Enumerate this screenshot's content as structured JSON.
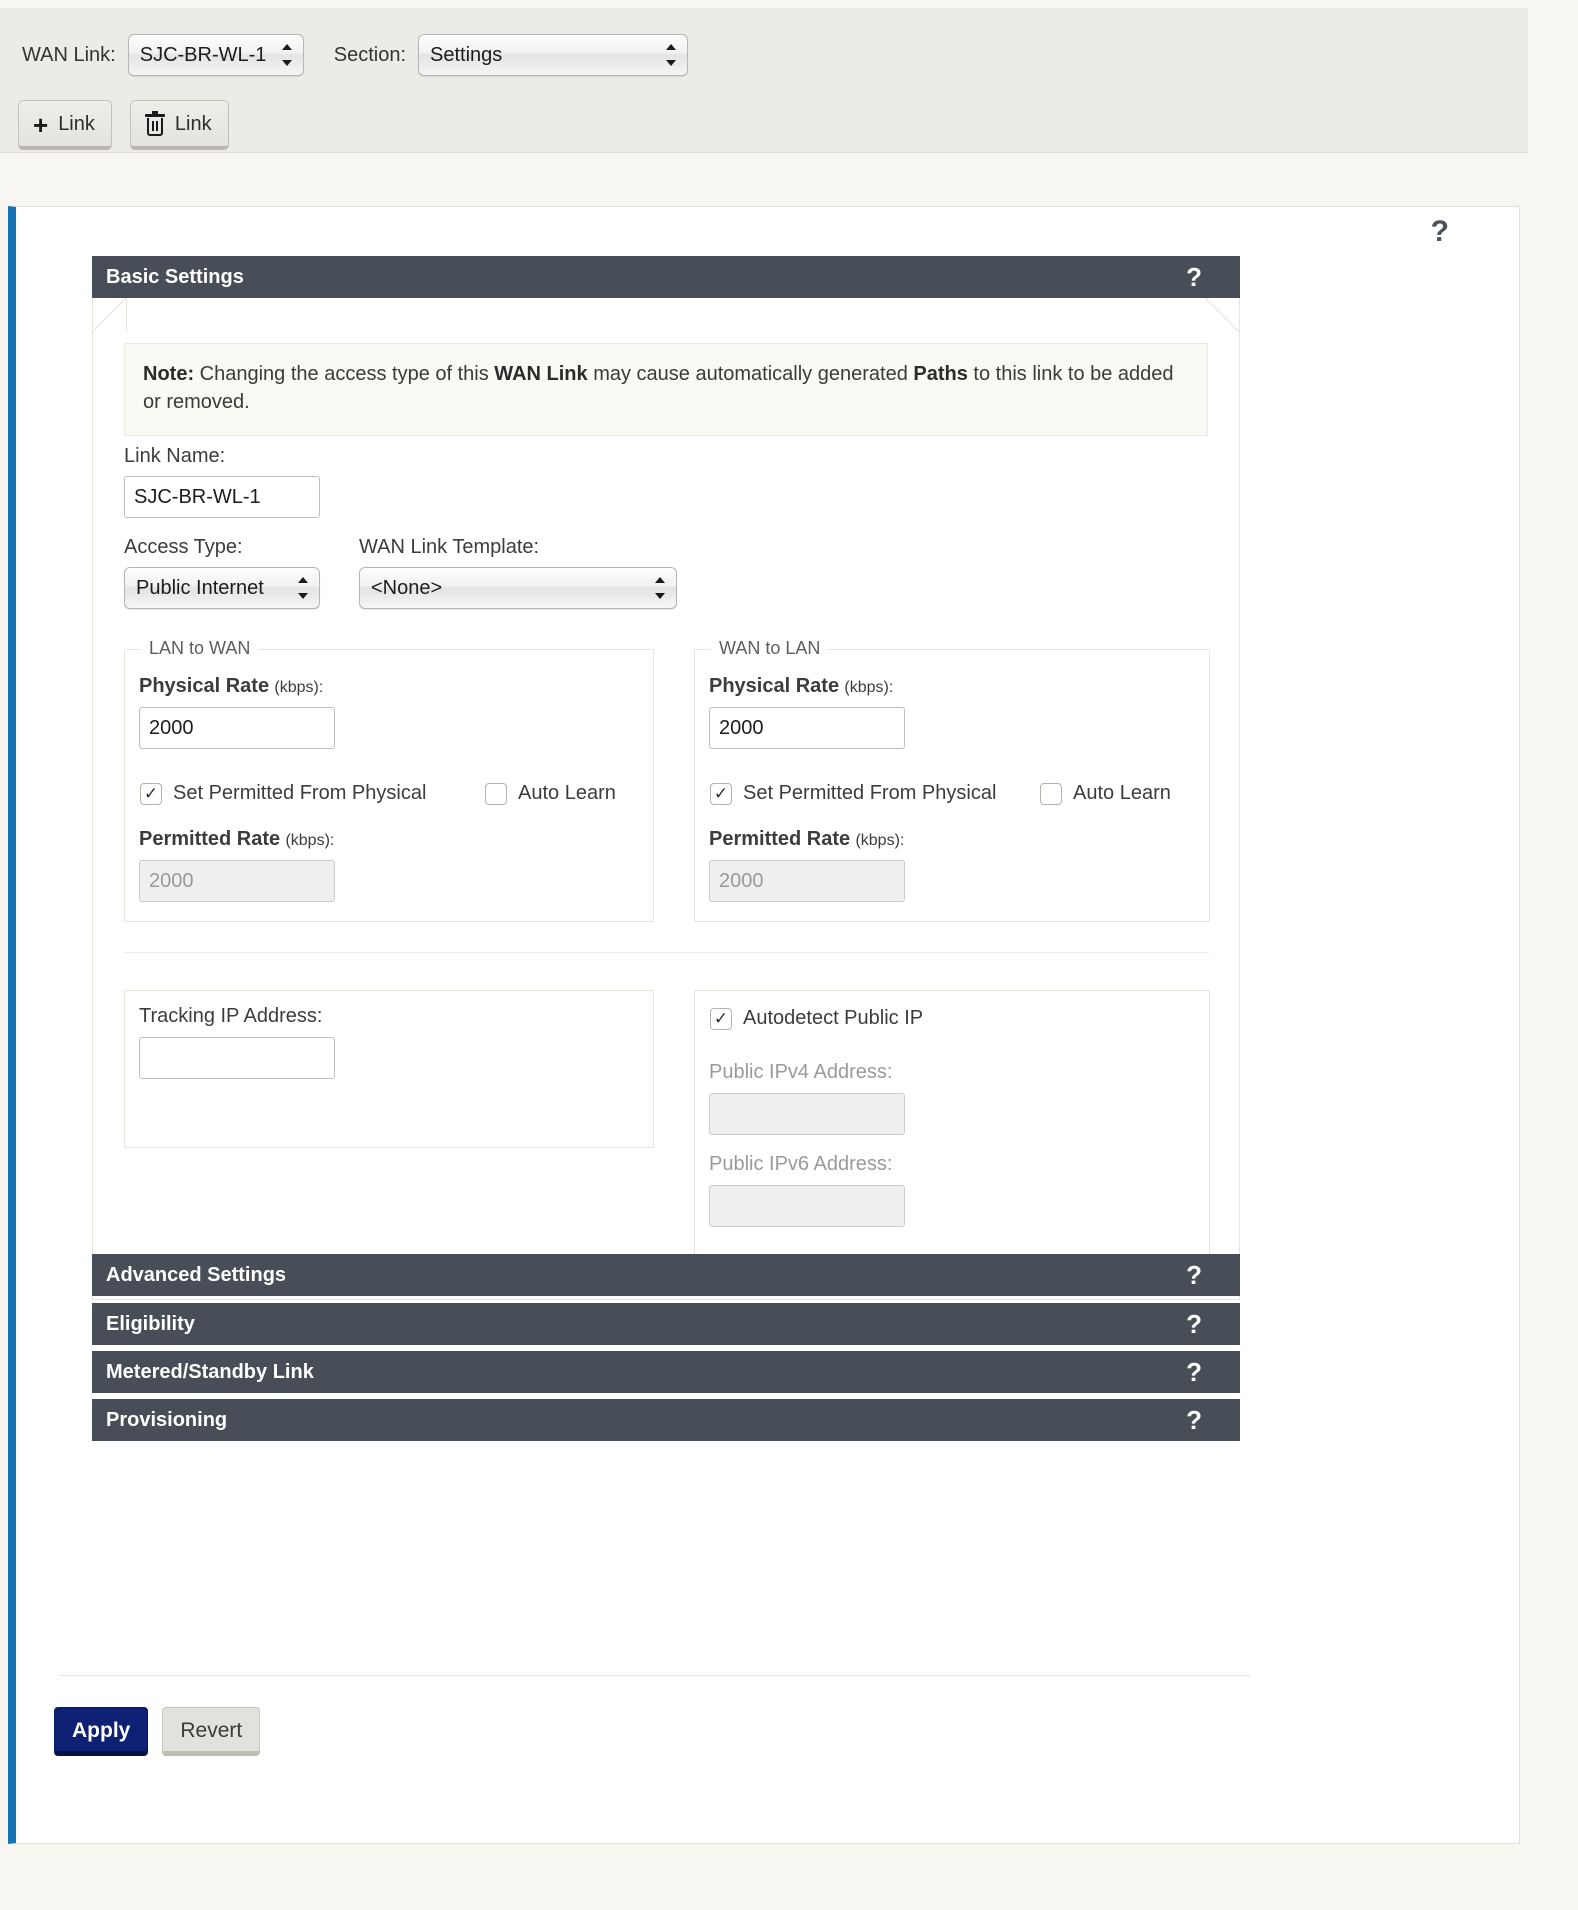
{
  "toolbar": {
    "wan_link_label": "WAN Link:",
    "wan_link_value": "SJC-BR-WL-1",
    "section_label": "Section:",
    "section_value": "Settings",
    "add_link_label": "Link",
    "delete_link_label": "Link"
  },
  "panel": {
    "top_help": "?"
  },
  "basic": {
    "title": "Basic Settings",
    "help": "?",
    "note_prefix": "Note:",
    "note_part1": " Changing the access type of this ",
    "note_bold1": "WAN Link",
    "note_part2": " may cause automatically generated ",
    "note_bold2": "Paths",
    "note_part3": " to this link to be added or removed.",
    "link_name_label": "Link Name:",
    "link_name_value": "SJC-BR-WL-1",
    "access_type_label": "Access Type:",
    "access_type_value": "Public Internet",
    "template_label": "WAN Link Template:",
    "template_value": "<None>"
  },
  "lan_to_wan": {
    "legend": "LAN to WAN",
    "physical_rate_label": "Physical Rate",
    "physical_rate_unit": "(kbps):",
    "physical_rate_value": "2000",
    "set_permitted_label": "Set Permitted From Physical",
    "set_permitted_checked": true,
    "auto_learn_label": "Auto Learn",
    "auto_learn_checked": false,
    "permitted_rate_label": "Permitted Rate",
    "permitted_rate_unit": "(kbps):",
    "permitted_rate_value": "2000"
  },
  "wan_to_lan": {
    "legend": "WAN to LAN",
    "physical_rate_label": "Physical Rate",
    "physical_rate_unit": "(kbps):",
    "physical_rate_value": "2000",
    "set_permitted_label": "Set Permitted From Physical",
    "set_permitted_checked": true,
    "auto_learn_label": "Auto Learn",
    "auto_learn_checked": false,
    "permitted_rate_label": "Permitted Rate",
    "permitted_rate_unit": "(kbps):",
    "permitted_rate_value": "2000"
  },
  "tracking": {
    "label": "Tracking IP Address:",
    "value": ""
  },
  "public_ip": {
    "autodetect_label": "Autodetect Public IP",
    "autodetect_checked": true,
    "ipv4_label": "Public IPv4 Address:",
    "ipv4_value": "",
    "ipv6_label": "Public IPv6 Address:",
    "ipv6_value": ""
  },
  "sections": [
    {
      "title": "Advanced Settings",
      "help": "?"
    },
    {
      "title": "Eligibility",
      "help": "?"
    },
    {
      "title": "Metered/Standby Link",
      "help": "?"
    },
    {
      "title": "Provisioning",
      "help": "?"
    }
  ],
  "footer": {
    "apply_label": "Apply",
    "revert_label": "Revert"
  },
  "colors": {
    "section_bar": "#474e57",
    "accent_left": "#1474b4",
    "primary_button": "#0d2074",
    "page_background": "#f7f6f1"
  }
}
